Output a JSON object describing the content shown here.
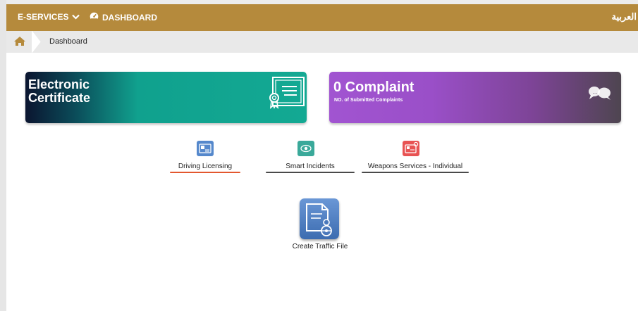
{
  "topbar": {
    "eservices_label": "E-SERVICES",
    "dashboard_label": "DASHBOARD",
    "language_label": "العربية"
  },
  "breadcrumb": {
    "current": "Dashboard"
  },
  "cards": {
    "certificate": {
      "title": "Electronic\nCertificate"
    },
    "complaint": {
      "title": "0 Complaint",
      "subtitle": "NO. of Submitted Complaints"
    }
  },
  "services": [
    {
      "label": "Driving Licensing"
    },
    {
      "label": "Smart Incidents"
    },
    {
      "label": "Weapons Services - Individual"
    }
  ],
  "actions": {
    "traffic_file_label": "Create Traffic File"
  },
  "colors": {
    "topbar": "#b58a3c",
    "driving_accent": "#e3572f",
    "incidents_accent": "#4a4a4a",
    "weapons_accent": "#4a4a4a"
  },
  "icons": [
    "chevron-down-icon",
    "dashboard-icon",
    "home-icon",
    "certificate-icon",
    "chat-bubbles-icon",
    "id-card-icon",
    "eye-icon",
    "id-card-alert-icon",
    "traffic-file-icon"
  ]
}
